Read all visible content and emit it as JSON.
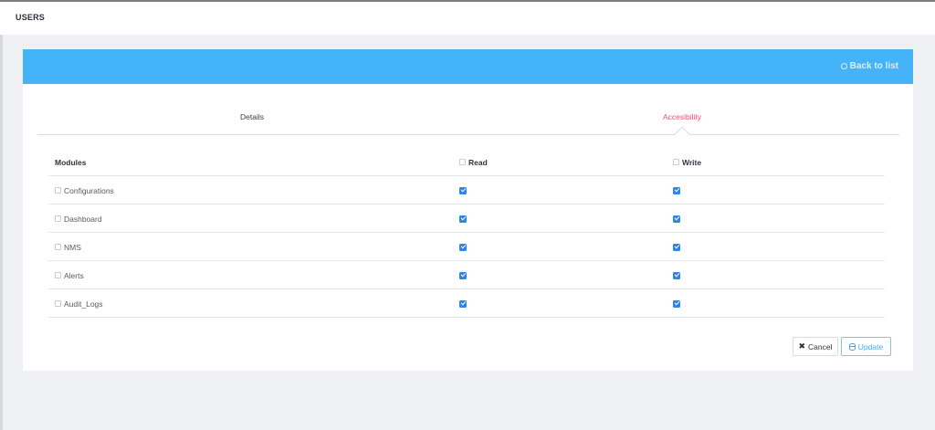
{
  "header": {
    "title": "USERS"
  },
  "card": {
    "back_link": "Back to list",
    "tabs": [
      {
        "label": "Details",
        "active": false
      },
      {
        "label": "Accesibility",
        "active": true
      }
    ],
    "table": {
      "columns": {
        "modules": "Modules",
        "read": "Read",
        "write": "Write"
      },
      "rows": [
        {
          "module": "Configurations",
          "read": true,
          "write": true
        },
        {
          "module": "Dashboard",
          "read": true,
          "write": true
        },
        {
          "module": "NMS",
          "read": true,
          "write": true
        },
        {
          "module": "Alerts",
          "read": true,
          "write": true
        },
        {
          "module": "Audit_Logs",
          "read": true,
          "write": true
        }
      ]
    },
    "buttons": {
      "cancel": "Cancel",
      "update": "Update"
    }
  },
  "colors": {
    "header_bar": "#45b3f7",
    "active_tab": "#f0506e",
    "checkbox": "#2a86e8"
  },
  "icons": {
    "back": "circle-icon",
    "cancel": "x-icon",
    "update": "database-icon"
  }
}
